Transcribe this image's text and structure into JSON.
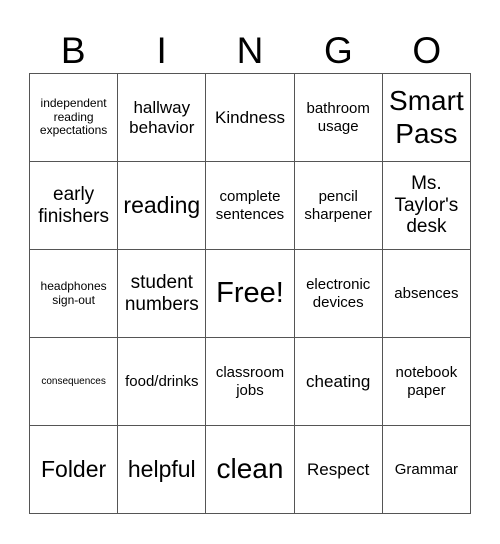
{
  "header": {
    "letters": [
      "B",
      "I",
      "N",
      "G",
      "O"
    ]
  },
  "board": {
    "rows": [
      [
        "independent reading expectations",
        "hallway behavior",
        "Kindness",
        "bathroom usage",
        "Smart Pass"
      ],
      [
        "early finishers",
        "reading",
        "complete sentences",
        "pencil sharpener",
        "Ms. Taylor's desk"
      ],
      [
        "headphones sign-out",
        "student numbers",
        "Free!",
        "electronic devices",
        "absences"
      ],
      [
        "consequences",
        "food/drinks",
        "classroom jobs",
        "cheating",
        "notebook paper"
      ],
      [
        "Folder",
        "helpful",
        "clean",
        "Respect",
        "Grammar"
      ]
    ]
  }
}
